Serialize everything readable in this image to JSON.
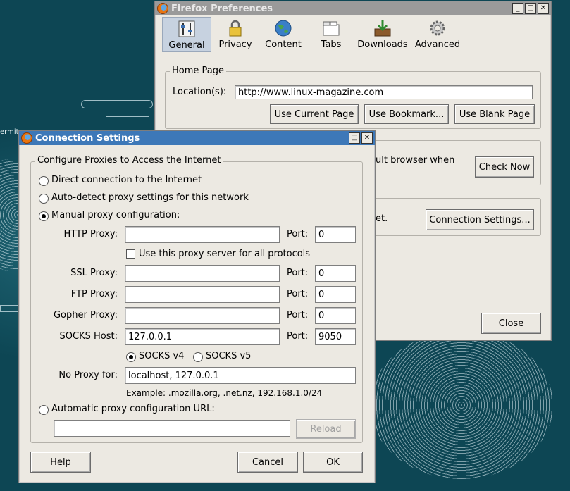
{
  "desktop": {
    "partial_text": "ermit"
  },
  "prefs": {
    "title": "Firefox Preferences",
    "tabs": [
      {
        "label": "General"
      },
      {
        "label": "Privacy"
      },
      {
        "label": "Content"
      },
      {
        "label": "Tabs"
      },
      {
        "label": "Downloads"
      },
      {
        "label": "Advanced"
      }
    ],
    "home_page": {
      "legend": "Home Page",
      "location_label": "Location(s):",
      "location_value": "http://www.linux-magazine.com",
      "use_current": "Use Current Page",
      "use_bookmark": "Use Bookmark...",
      "use_blank": "Use Blank Page"
    },
    "default_browser_text": "ult browser when",
    "check_now": "Check Now",
    "connection_text": "et.",
    "connection_settings": "Connection Settings...",
    "close": "Close"
  },
  "conn": {
    "title": "Connection Settings",
    "legend": "Configure Proxies to Access the Internet",
    "direct": "Direct connection to the Internet",
    "auto_detect": "Auto-detect proxy settings for this network",
    "manual": "Manual proxy configuration:",
    "port_label": "Port:",
    "http_label": "HTTP Proxy:",
    "http_value": "",
    "http_port": "0",
    "use_all": "Use this proxy server for all protocols",
    "ssl_label": "SSL Proxy:",
    "ssl_value": "",
    "ssl_port": "0",
    "ftp_label": "FTP Proxy:",
    "ftp_value": "",
    "ftp_port": "0",
    "gopher_label": "Gopher Proxy:",
    "gopher_value": "",
    "gopher_port": "0",
    "socks_label": "SOCKS Host:",
    "socks_value": "127.0.0.1",
    "socks_port": "9050",
    "socks_v4": "SOCKS v4",
    "socks_v5": "SOCKS v5",
    "no_proxy_label": "No Proxy for:",
    "no_proxy_value": "localhost, 127.0.0.1",
    "example": "Example: .mozilla.org, .net.nz, 192.168.1.0/24",
    "auto_url": "Automatic proxy configuration URL:",
    "auto_url_value": "",
    "reload": "Reload",
    "help": "Help",
    "cancel": "Cancel",
    "ok": "OK"
  },
  "colors": {
    "desktop": "#0d4654",
    "active_title": "#3d78b8",
    "inactive_title": "#9a9a9a",
    "window": "#ece9e2"
  }
}
